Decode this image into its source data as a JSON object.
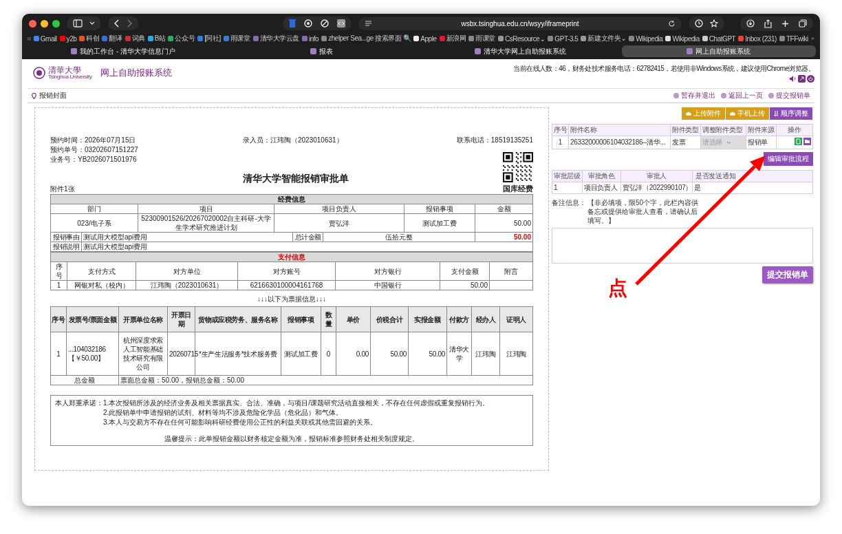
{
  "browser": {
    "url": "wsbx.tsinghua.edu.cn/wsyy/iframeprint",
    "bookmarks": [
      {
        "label": "Gmail",
        "color": "#4285f4"
      },
      {
        "label": "y2b",
        "color": "#ff0000"
      },
      {
        "label": "科创",
        "color": "#e8541c"
      },
      {
        "label": "翻译",
        "color": "#3b6fd9"
      },
      {
        "label": "词典",
        "color": "#c9302c"
      },
      {
        "label": "B站",
        "color": "#23ade5"
      },
      {
        "label": "公众号",
        "color": "#2aae67"
      },
      {
        "label": "[阿社]",
        "color": "#2f7de1"
      },
      {
        "label": "雨课堂",
        "color": "#3a7bd5"
      },
      {
        "label": "清华大学云盘",
        "color": "#8a6bb0"
      },
      {
        "label": "info",
        "color": "#8a6bb0"
      },
      {
        "label": "zhelper Sea...ge 搜索界面 🔍",
        "color": "#888888"
      },
      {
        "label": "Apple",
        "color": "#eeeeee"
      },
      {
        "label": "新浪网",
        "color": "#e6162d"
      },
      {
        "label": "雨课堂",
        "color": "#888888"
      },
      {
        "label": "CsResource⌄",
        "color": "#999999"
      },
      {
        "label": "GPT-3.5",
        "color": "#888888"
      },
      {
        "label": "新建文件夹⌄",
        "color": "#999999"
      },
      {
        "label": "Wikipedia",
        "color": "#888888"
      },
      {
        "label": "Wikipedia",
        "color": "#dddddd"
      },
      {
        "label": "ChatGPT",
        "color": "#cccccc"
      },
      {
        "label": "Inbox (231)",
        "color": "#ea4335"
      },
      {
        "label": "TFFwiki",
        "color": "#888888"
      }
    ],
    "tabs": [
      {
        "label": "我的工作台 - 清华大学信息门户",
        "selected": false
      },
      {
        "label": "报表",
        "selected": false
      },
      {
        "label": "清华大学网上自助报账系统",
        "selected": false
      },
      {
        "label": "网上自助报账系统",
        "selected": true
      }
    ]
  },
  "header": {
    "logo_cn": "清華大學",
    "logo_en": "Tsinghua University",
    "title": "网上自助报账系统",
    "notice": "当前在线人数：46，财务处技术服务电话：62782415，若使用非Windows系统，建议使用Chrome浏览器。"
  },
  "breadcrumb": {
    "label": "报销封面",
    "actions": [
      "暂存并退出",
      "返回上一页",
      "提交报销单"
    ]
  },
  "form": {
    "meta_left": [
      "预约时间：2026年07月15日",
      "预约单号：03202607151227",
      "业务号：YB2026071501976"
    ],
    "entered_by": "录入员：江玮陶（2023010631）",
    "phone": "联系电话：18519135251",
    "title": "清华大学智能报销审批单",
    "attachments": "附件1张",
    "fund_type": "国库经费",
    "funding": {
      "title": "经费信息",
      "headers": [
        "部门",
        "项目",
        "项目负责人",
        "报销事项",
        "金额"
      ],
      "dept": "023/电子系",
      "project": "52300901526/20267020002自主科研-大学生学术研究推进计划",
      "leader": "贾弘洋",
      "item": "测试加工费",
      "amount": "50.00",
      "reason_label": "报销事由",
      "reason": "测试用大模型api费用",
      "total_label": "总计金额",
      "total_words": "伍拾元整",
      "total_amount": "50.00",
      "note_label": "报销说明",
      "note": "测试用大模型api费用"
    },
    "payment": {
      "title": "支付信息",
      "headers": [
        "序号",
        "支付方式",
        "对方单位",
        "对方账号",
        "对方银行",
        "支付金额",
        "附言"
      ],
      "rows": [
        [
          "1",
          "网银对私（校内）",
          "江玮陶（2023010631）",
          "6216630100004161768",
          "中国银行",
          "50.00"
        ]
      ]
    },
    "invoice_divider": "↓↓↓以下为票据信息↓↓↓",
    "invoices": {
      "headers": [
        "序号",
        "发票号/票面金额",
        "开票单位名称",
        "开票日期",
        "货物或应税劳务、服务名称",
        "报销事项",
        "数量",
        "单价",
        "价税合计",
        "实报金额",
        "付款方",
        "经办人",
        "证明人"
      ],
      "rows": [
        {
          "index": "1",
          "number": "...104032186",
          "face": "【￥50.00】",
          "issuer": "杭州深度求索人工智能基础技术研究有限公司",
          "date": "20260715",
          "goods": "*生产生活服务*技术服务费",
          "item": "测试加工费",
          "qty": "0",
          "unit_price": "0.00",
          "total": "50.00",
          "actual": "50.00",
          "payer": "清华大学",
          "handler": "江玮陶",
          "certifier": "江玮陶"
        }
      ],
      "total_label": "总金额",
      "total_text": "票面总金额：50.00，报销总金额：50.00"
    },
    "commitment": {
      "label": "本人郑重承诺：",
      "items": [
        "1.本次报销所涉及的经济业务及相关票据真实、合法、准确，与项目/课题研究活动直接相关，不存在任何虚假或重复报销行为。",
        "2.此报销单中申请报销的试剂、材料等均不涉及危险化学品（危化品）和气体。",
        "3.本人与交易方不存在任何可能影响科研经费使用公正性的利益关联或其他需回避的关系。"
      ],
      "tip": "温馨提示：此单报销金额以财务核定金额为准，报销标准参照财务处相关制度规定。"
    }
  },
  "panel": {
    "toolbar": [
      {
        "label": "上传附件",
        "kind": "upload"
      },
      {
        "label": "手机上传",
        "kind": "upload"
      },
      {
        "label": "顺序调整",
        "kind": "sort"
      }
    ],
    "attach_headers": [
      "序号",
      "附件名称",
      "附件类型",
      "调整附件类型",
      "附件来源",
      "操作"
    ],
    "attachments": [
      {
        "index": "1",
        "name": "26332000006104032186--清华...",
        "type": "发票",
        "adjust_placeholder": "请选择",
        "source": "报销单"
      }
    ],
    "edit_flow": "编辑审批流程",
    "approval_headers": [
      "审批层级",
      "审批角色",
      "审批人",
      "是否发送通知"
    ],
    "approvals": [
      {
        "level": "1",
        "role": "项目负责人",
        "approver": "贾弘洋（2022990107）",
        "notify": "是"
      }
    ],
    "remark_label": "备注信息：",
    "remark_hint": "【非必填项，限50个字，此栏内容供备忘或提供给审批人查看，请确认后填写。】",
    "submit": "提交报销单"
  },
  "annotation": {
    "label": "点"
  }
}
